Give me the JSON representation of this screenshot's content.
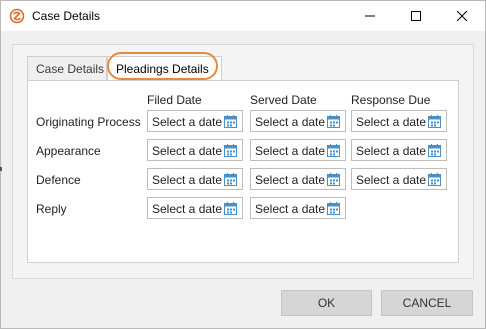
{
  "window": {
    "title": "Case Details",
    "icons": {
      "app": "app-logo-icon",
      "minimize": "minimize-icon",
      "maximize": "maximize-icon",
      "close": "close-icon"
    }
  },
  "tabs": [
    {
      "label": "Case Details",
      "active": false
    },
    {
      "label": "Pleadings Details",
      "active": true
    }
  ],
  "colors": {
    "tab_highlight": "#e58a3b",
    "calendar_icon": "#4a90c8"
  },
  "grid": {
    "columns": [
      "Filed Date",
      "Served Date",
      "Response Due"
    ],
    "placeholder": "Select a date",
    "calendar_icon": "calendar-icon",
    "rows": [
      {
        "label": "Originating Process",
        "fields": 3
      },
      {
        "label": "Appearance",
        "fields": 3
      },
      {
        "label": "Defence",
        "fields": 3
      },
      {
        "label": "Reply",
        "fields": 2
      }
    ]
  },
  "buttons": {
    "ok": "OK",
    "cancel": "CANCEL"
  }
}
